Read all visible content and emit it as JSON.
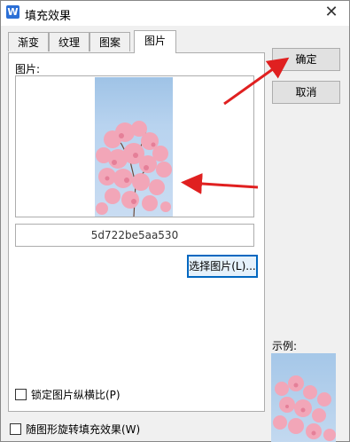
{
  "window": {
    "app_icon_letter": "W",
    "title": "填充效果",
    "close_glyph": "✕"
  },
  "tabs": [
    {
      "label": "渐变",
      "active": false
    },
    {
      "label": "纹理",
      "active": false
    },
    {
      "label": "图案",
      "active": false
    },
    {
      "label": "图片",
      "active": true
    }
  ],
  "picture_tab": {
    "label": "图片:",
    "file_name": "5d722be5aa530",
    "select_button": "选择图片(L)...",
    "lock_aspect_label": "锁定图片纵横比(P)",
    "lock_aspect_checked": false
  },
  "rotate_with_shape_label": "随图形旋转填充效果(W)",
  "rotate_with_shape_checked": false,
  "buttons": {
    "ok": "确定",
    "cancel": "取消"
  },
  "example_label": "示例:",
  "colors": {
    "arrow": "#e02020",
    "blossom": "#f2a6b8",
    "sky": "#b8d3ef",
    "focus": "#0067c0"
  }
}
